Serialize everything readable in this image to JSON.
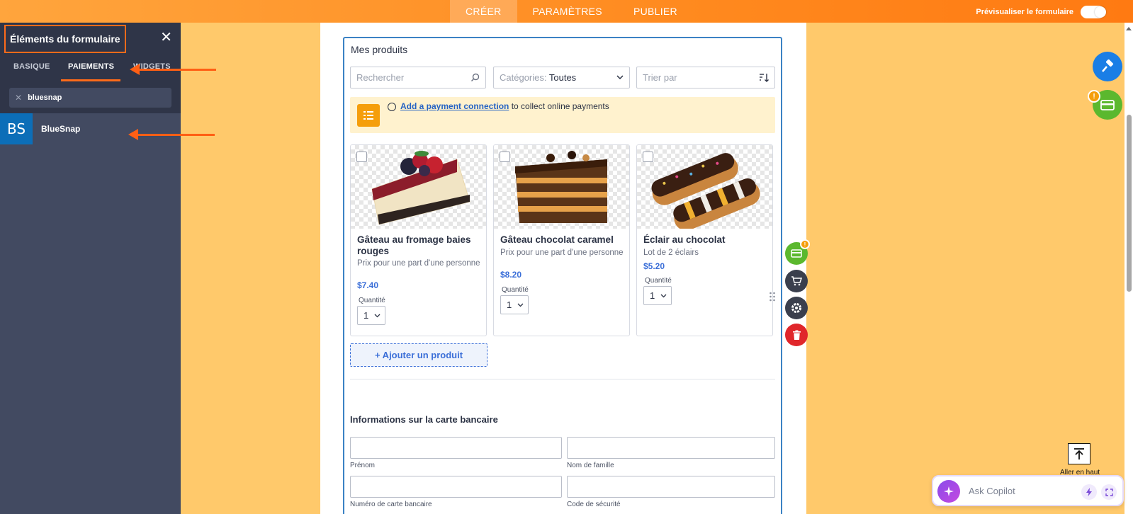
{
  "topbar": {
    "tabs": [
      {
        "label": "CRÉER"
      },
      {
        "label": "PARAMÈTRES"
      },
      {
        "label": "PUBLIER"
      }
    ],
    "preview_label": "Prévisualiser le formulaire"
  },
  "sidebar": {
    "title": "Éléments du formulaire",
    "close_glyph": "✕",
    "tabs": [
      {
        "label": "BASIQUE"
      },
      {
        "label": "PAIEMENTS"
      },
      {
        "label": "WIDGETS"
      }
    ],
    "search_value": "bluesnap",
    "clear_glyph": "✕",
    "results": [
      {
        "icon_text": "BS",
        "label": "BlueSnap"
      }
    ]
  },
  "product_list": {
    "title": "Mes produits",
    "search_placeholder": "Rechercher",
    "category_label": "Catégories:",
    "category_value": "Toutes",
    "sort_placeholder": "Trier par",
    "notice": {
      "link": "Add a payment connection",
      "text": " to collect online payments"
    },
    "products": [
      {
        "name": "Gâteau au fromage baies rouges",
        "description": "Prix pour une part d'une personne",
        "price": "$7.40",
        "qty_label": "Quantité",
        "qty": "1"
      },
      {
        "name": "Gâteau chocolat caramel",
        "description": "Prix pour une part d'une personne",
        "price": "$8.20",
        "qty_label": "Quantité",
        "qty": "1"
      },
      {
        "name": "Éclair au chocolat",
        "description": "Lot de 2 éclairs",
        "price": "$5.20",
        "qty_label": "Quantité",
        "qty": "1"
      }
    ],
    "add_product_label": "+ Ajouter un produit"
  },
  "card_info": {
    "title": "Informations sur la carte bancaire",
    "fields": [
      {
        "label": "Prénom"
      },
      {
        "label": "Nom de famille"
      },
      {
        "label": "Numéro de carte bancaire"
      },
      {
        "label": "Code de sécurité"
      }
    ]
  },
  "badges": {
    "warning": "!"
  },
  "go_top_label": "Aller en haut",
  "copilot": {
    "placeholder": "Ask Copilot"
  },
  "colors": {
    "topbar": "#ff8a1f",
    "sidebar": "#424a61",
    "accent": "#ff6b1a",
    "link": "#3b6fd8",
    "payment_green": "#5bb82e",
    "danger": "#e0262b"
  }
}
